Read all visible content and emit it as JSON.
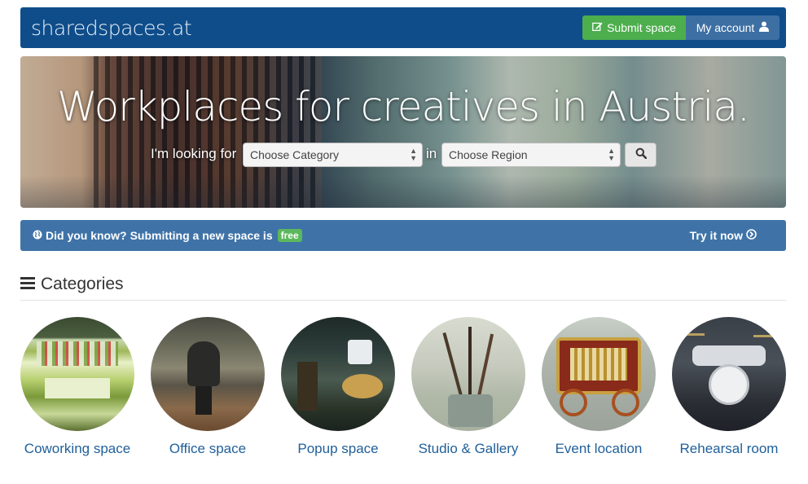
{
  "navbar": {
    "logo": "sharedspaces.at",
    "submit_label": "Submit space",
    "account_label": "My account"
  },
  "hero": {
    "title": "Workplaces for creatives in Austria.",
    "looking_label": "I'm looking for",
    "in_label": "in",
    "category_select": {
      "selected": "Choose Category"
    },
    "region_select": {
      "selected": "Choose Region"
    }
  },
  "info": {
    "did_you_know": "Did you know?",
    "text": "Submitting a new space is",
    "badge": "free",
    "cta": "Try it now"
  },
  "categories": {
    "heading": "Categories",
    "items": [
      {
        "label": "Coworking space"
      },
      {
        "label": "Office space"
      },
      {
        "label": "Popup space"
      },
      {
        "label": "Studio & Gallery"
      },
      {
        "label": "Event location"
      },
      {
        "label": "Rehearsal room"
      }
    ]
  },
  "colors": {
    "navbar_bg": "#0f4d8a",
    "submit_green": "#4cae4c",
    "info_bar_bg": "#3f73a8",
    "link_blue": "#1f5f99"
  },
  "icons": [
    "edit-icon",
    "user-icon",
    "search-icon",
    "globe-icon",
    "arrow-circle-right-icon",
    "bars-icon"
  ]
}
